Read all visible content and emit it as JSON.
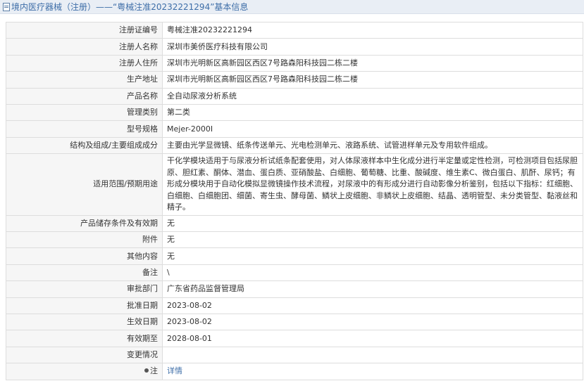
{
  "header": {
    "title": "境内医疗器械（注册）——“粤械注准20232221294”基本信息"
  },
  "fields": [
    {
      "label": "注册证编号",
      "value": "粤械注准20232221294"
    },
    {
      "label": "注册人名称",
      "value": "深圳市美侨医疗科技有限公司"
    },
    {
      "label": "注册人住所",
      "value": "深圳市光明新区高新园区西区7号路森阳科技园二栋二楼"
    },
    {
      "label": "生产地址",
      "value": "深圳市光明新区高新园区西区7号路森阳科技园二栋二楼"
    },
    {
      "label": "产品名称",
      "value": "全自动尿液分析系统"
    },
    {
      "label": "管理类别",
      "value": "第二类"
    },
    {
      "label": "型号规格",
      "value": "Mejer-2000I"
    },
    {
      "label": "结构及组成/主要组成成分",
      "value": "主要由光学显微镜、纸条传送单元、光电检测单元、液路系统、试管进样单元及专用软件组成。"
    },
    {
      "label": "适用范围/预期用途",
      "value": "干化学模块适用于与尿液分析试纸条配套使用，对人体尿液样本中生化成分进行半定量或定性检测，可检测项目包括尿胆原、胆红素、酮体、潜血、蛋白质、亚硝酸盐、白细胞、葡萄糖、比重、酸碱度、维生素C、微白蛋白、肌酐、尿钙；有形成分模块用于自动化模拟显微镜操作技术流程，对尿液中的有形成分进行自动影像分析鉴别，包括以下指标：红细胞、白细胞、白细胞团、细菌、寄生虫、酵母菌、鳞状上皮细胞、非鳞状上皮细胞、结晶、透明管型、未分类管型、黏液丝和精子。"
    },
    {
      "label": "产品储存条件及有效期",
      "value": "无"
    },
    {
      "label": "附件",
      "value": "无"
    },
    {
      "label": "其他内容",
      "value": "无"
    },
    {
      "label": "备注",
      "value": "\\"
    },
    {
      "label": "审批部门",
      "value": "广东省药品监督管理局"
    },
    {
      "label": "批准日期",
      "value": "2023-08-02"
    },
    {
      "label": "生效日期",
      "value": "2023-08-02"
    },
    {
      "label": "有效期至",
      "value": "2028-08-01"
    },
    {
      "label": "变更情况",
      "value": ""
    }
  ],
  "footer_row": {
    "label": "注",
    "link_text": "详情"
  }
}
